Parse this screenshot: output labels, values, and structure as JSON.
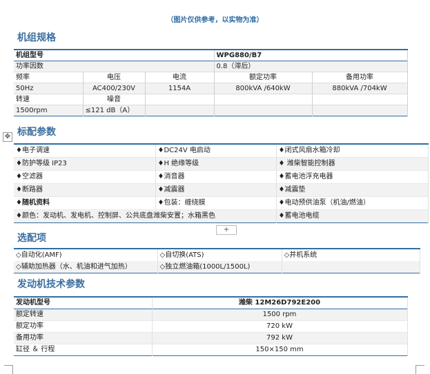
{
  "note": "（图片仅供参考，以实物为准）",
  "sections": {
    "specs": "机组规格",
    "standard": "标配参数",
    "optional": "选配项",
    "engine": "发动机技术参数"
  },
  "spec_table": {
    "model_label": "机组型号",
    "model_value": "WPG880/B7",
    "pf_label": "功率因数",
    "pf_value": "0.8（滞后）",
    "headers": [
      "频率",
      "电压",
      "电流",
      "额定功率",
      "备用功率"
    ],
    "values": [
      "50Hz",
      "AC400/230V",
      "1154A",
      "800kVA /640kW",
      "880kVA /704kW"
    ],
    "speed_label": "转速",
    "noise_label": "噪音",
    "speed_value": "1500rpm",
    "noise_value": "≤121 dB（A）"
  },
  "standard_items": [
    [
      "♦电子调速",
      "♦DC24V 电启动",
      "♦闭式风扇水箱冷却"
    ],
    [
      "♦防护等级 IP23",
      "♦H 绝缘等级",
      "♦ 潍柴智能控制器"
    ],
    [
      "♦空滤器",
      "♦消音器",
      "♦蓄电池浮充电器"
    ],
    [
      "♦断路器",
      "♦减震器",
      "♦减震垫"
    ],
    [
      "♦随机资料",
      "♦包装：缠绕膜",
      "♦电动预供油泵（机油/燃油）"
    ],
    [
      "♦颜色：发动机、发电机、控制屏、公共底盘潍柴安置；水箱黑色",
      "",
      "♦蓄电池电缆"
    ]
  ],
  "optional_items": [
    [
      "◇自动化(AMF)",
      "◇自切换(ATS)",
      "◇并机系统"
    ],
    [
      "◇辅助加热器（水、机油和进气加热）",
      "◇独立燃油箱(1000L/1500L)",
      ""
    ]
  ],
  "engine_table": {
    "header_label": "发动机型号",
    "header_value": "潍柴 12M26D792E200",
    "rows": [
      {
        "label": "额定转速",
        "value": "1500 rpm"
      },
      {
        "label": "额定功率",
        "value": "720 kW"
      },
      {
        "label": "备用功率",
        "value": "792 kW"
      },
      {
        "label": "缸径 ＆ 行程",
        "value": "150×150 mm"
      }
    ]
  },
  "ui": {
    "move_handle": "✥",
    "add_row": "+"
  }
}
